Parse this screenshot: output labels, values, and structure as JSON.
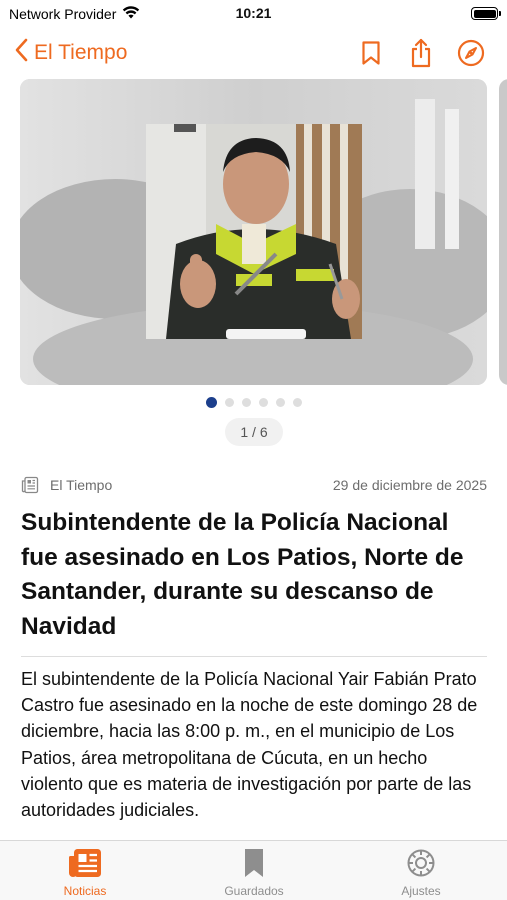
{
  "status_bar": {
    "carrier": "Network Provider",
    "time": "10:21",
    "wifi_icon": "wifi-icon",
    "battery_icon": "battery-icon"
  },
  "nav": {
    "back_label": "El Tiempo",
    "actions": [
      "bookmark-icon",
      "share-icon",
      "compass-icon"
    ],
    "accent_color": "#ee6a20"
  },
  "gallery": {
    "counter": "1 / 6",
    "current": 1,
    "total": 6,
    "dot_active_color": "#1c3f8c"
  },
  "article": {
    "source": "El Tiempo",
    "date": "29 de diciembre de 2025",
    "headline": "Subintendente de la Policía Nacional fue asesinado en Los Patios, Norte de Santander, durante su descanso de Navidad",
    "body": "El subintendente de la Policía Nacional Yair Fabián Prato Castro fue asesinado en la noche de este domingo 28 de diciembre, hacia las 8:00 p. m., en el municipio de Los Patios, área metropolitana de Cúcuta, en un hecho violento que es materia de investigación por parte de las autoridades judiciales."
  },
  "tabs": [
    {
      "label": "Noticias",
      "icon": "newspaper-icon",
      "active": true
    },
    {
      "label": "Guardados",
      "icon": "bookmark-icon",
      "active": false
    },
    {
      "label": "Ajustes",
      "icon": "gear-icon",
      "active": false
    }
  ]
}
